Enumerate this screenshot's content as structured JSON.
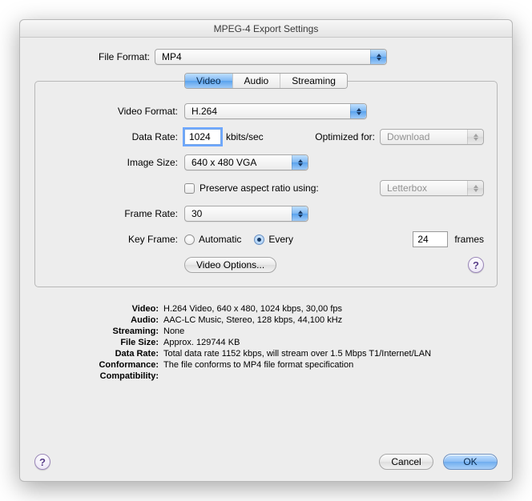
{
  "window": {
    "title": "MPEG-4 Export Settings"
  },
  "fileFormat": {
    "label": "File Format:",
    "value": "MP4"
  },
  "tabs": {
    "items": [
      "Video",
      "Audio",
      "Streaming"
    ],
    "selected": 0
  },
  "video": {
    "format": {
      "label": "Video Format:",
      "value": "H.264"
    },
    "dataRate": {
      "label": "Data Rate:",
      "value": "1024",
      "unit": "kbits/sec"
    },
    "optimized": {
      "label": "Optimized for:",
      "value": "Download"
    },
    "imageSize": {
      "label": "Image Size:",
      "value": "640 x 480 VGA"
    },
    "preserve": {
      "label": "Preserve aspect ratio using:",
      "checked": false,
      "mode": "Letterbox"
    },
    "frameRate": {
      "label": "Frame Rate:",
      "value": "30"
    },
    "keyFrame": {
      "label": "Key Frame:",
      "options": {
        "auto": "Automatic",
        "every": "Every"
      },
      "selected": "every",
      "value": "24",
      "unit": "frames"
    },
    "optionsButton": "Video Options..."
  },
  "summary": {
    "video": {
      "k": "Video:",
      "v": "H.264 Video, 640 x 480, 1024 kbps, 30,00 fps"
    },
    "audio": {
      "k": "Audio:",
      "v": "AAC-LC Music, Stereo, 128 kbps, 44,100 kHz"
    },
    "streaming": {
      "k": "Streaming:",
      "v": "None"
    },
    "fileSize": {
      "k": "File Size:",
      "v": "Approx. 129744 KB"
    },
    "dataRate": {
      "k": "Data Rate:",
      "v": "Total data rate 1152 kbps, will stream over 1.5 Mbps T1/Internet/LAN"
    },
    "conformance": {
      "k": "Conformance:",
      "v": "The file conforms to MP4 file format specification"
    },
    "compat": {
      "k": "Compatibility:",
      "v": ""
    }
  },
  "buttons": {
    "cancel": "Cancel",
    "ok": "OK"
  },
  "help": "?"
}
